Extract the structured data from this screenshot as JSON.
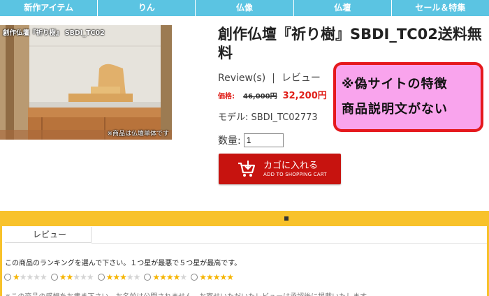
{
  "nav": {
    "items": [
      "新作アイテム",
      "りん",
      "仏像",
      "仏壇",
      "セール＆特集"
    ]
  },
  "photo": {
    "caption": "創作仏壇『祈り樹』 SBDI_TC02",
    "note": "※商品は仏壇単体です"
  },
  "product": {
    "title": "創作仏壇『祈り樹』SBDI_TC02送料無料",
    "review_link": "Review(s)",
    "separator": "|",
    "review_jp": "レビュー",
    "price_label": "価格:",
    "price_old": "46,000円",
    "price_new": "32,200円",
    "model_text": "モデル: SBDI_TC02773",
    "qty_label": "数量:",
    "qty_value": "1"
  },
  "cart_button": {
    "main": "カゴに入れる",
    "sub": "ADD TO SHOPPING CART"
  },
  "warning": {
    "line1": "※偽サイトの特徴",
    "line2": "商品説明文がない"
  },
  "reviews": {
    "tab_label": "レビュー",
    "instruction": "この商品のランキングを選んで下さい。１つ星が最悪で５つ星が最高です。",
    "ratings": [
      1,
      2,
      3,
      4,
      5
    ],
    "bottom_text": "※この商品の感想をお書き下さい。お名前は公開されません。お寄せいただいたレビューは承認後に掲載いたします。"
  },
  "colors": {
    "nav": "#5bc4e2",
    "price": "#e0201a",
    "cart": "#c7130f",
    "band": "#f8c22b",
    "warning_bg": "#f9a4ed",
    "warning_border": "#e5191d"
  }
}
